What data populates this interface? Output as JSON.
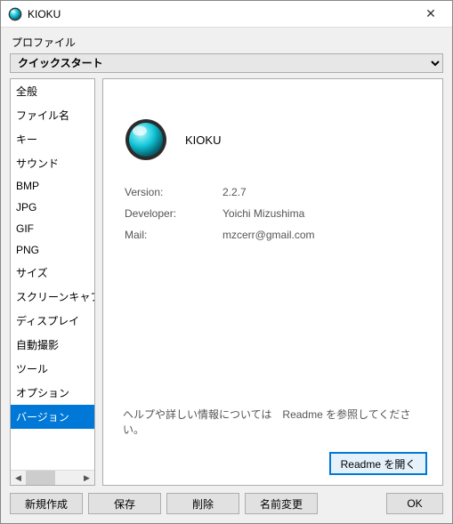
{
  "window": {
    "title": "KIOKU",
    "close_glyph": "✕"
  },
  "profile": {
    "label": "プロファイル",
    "selected": "クイックスタート"
  },
  "sidebar": {
    "items": [
      {
        "label": "全般"
      },
      {
        "label": "ファイル名"
      },
      {
        "label": "キー"
      },
      {
        "label": "サウンド"
      },
      {
        "label": "BMP"
      },
      {
        "label": "JPG"
      },
      {
        "label": "GIF"
      },
      {
        "label": "PNG"
      },
      {
        "label": "サイズ"
      },
      {
        "label": "スクリーンキャプチャ"
      },
      {
        "label": "ディスプレイ"
      },
      {
        "label": "自動撮影"
      },
      {
        "label": "ツール"
      },
      {
        "label": "オプション"
      },
      {
        "label": "バージョン"
      }
    ],
    "selected_index": 14,
    "scroll": {
      "left_glyph": "◀",
      "right_glyph": "▶"
    }
  },
  "content": {
    "app_name": "KIOKU",
    "rows": [
      {
        "label": "Version:",
        "value": "2.2.7"
      },
      {
        "label": "Developer:",
        "value": "Yoichi Mizushima"
      },
      {
        "label": "Mail:",
        "value": "mzcerr@gmail.com"
      }
    ],
    "help_text": "ヘルプや詳しい情報については　Readme を参照してください。",
    "readme_button": "Readme を開く"
  },
  "footer": {
    "new": "新規作成",
    "save": "保存",
    "delete": "削除",
    "rename": "名前変更",
    "ok": "OK"
  }
}
